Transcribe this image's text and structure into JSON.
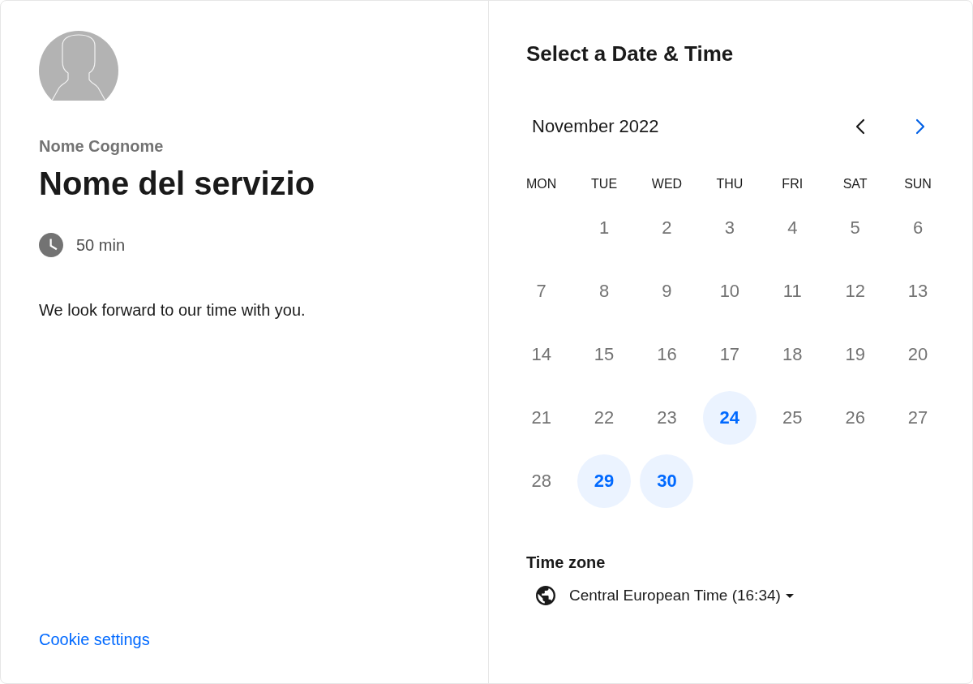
{
  "host": {
    "name": "Nome Cognome"
  },
  "event": {
    "title": "Nome del servizio",
    "duration": "50 min",
    "description": "We look forward to our time with you."
  },
  "footer": {
    "link": "Cookie settings"
  },
  "calendar": {
    "title": "Select a Date & Time",
    "month": "November 2022",
    "nav": [
      {
        "kind": "prev",
        "disabled": true
      },
      {
        "kind": "next",
        "disabled": false
      }
    ],
    "weekdays": [
      "MON",
      "TUE",
      "WED",
      "THU",
      "FRI",
      "SAT",
      "SUN"
    ],
    "weeks": [
      {
        "days": [
          {
            "label": "1",
            "available": false
          },
          {
            "label": "2",
            "available": false
          },
          {
            "label": "3",
            "available": false
          },
          {
            "label": "4",
            "available": false
          },
          {
            "label": "5",
            "available": false
          },
          {
            "label": "6",
            "available": false
          }
        ]
      },
      {
        "days": [
          {
            "label": "7",
            "available": false
          },
          {
            "label": "8",
            "available": false
          },
          {
            "label": "9",
            "available": false
          },
          {
            "label": "10",
            "available": false
          },
          {
            "label": "11",
            "available": false
          },
          {
            "label": "12",
            "available": false
          },
          {
            "label": "13",
            "available": false
          }
        ]
      },
      {
        "days": [
          {
            "label": "14",
            "available": false
          },
          {
            "label": "15",
            "available": false
          },
          {
            "label": "16",
            "available": false
          },
          {
            "label": "17",
            "available": false
          },
          {
            "label": "18",
            "available": false
          },
          {
            "label": "19",
            "available": false
          },
          {
            "label": "20",
            "available": false
          }
        ]
      },
      {
        "days": [
          {
            "label": "21",
            "available": false
          },
          {
            "label": "22",
            "available": false
          },
          {
            "label": "23",
            "available": false
          },
          {
            "label": "24",
            "available": true
          },
          {
            "label": "25",
            "available": false
          },
          {
            "label": "26",
            "available": false
          },
          {
            "label": "27",
            "available": false
          }
        ]
      },
      {
        "days": [
          {
            "label": "28",
            "available": false
          },
          {
            "label": "29",
            "available": true
          },
          {
            "label": "30",
            "available": true
          }
        ]
      }
    ]
  },
  "time_zone": {
    "label": "Time zone",
    "value": "Central European Time (16:34)"
  }
}
